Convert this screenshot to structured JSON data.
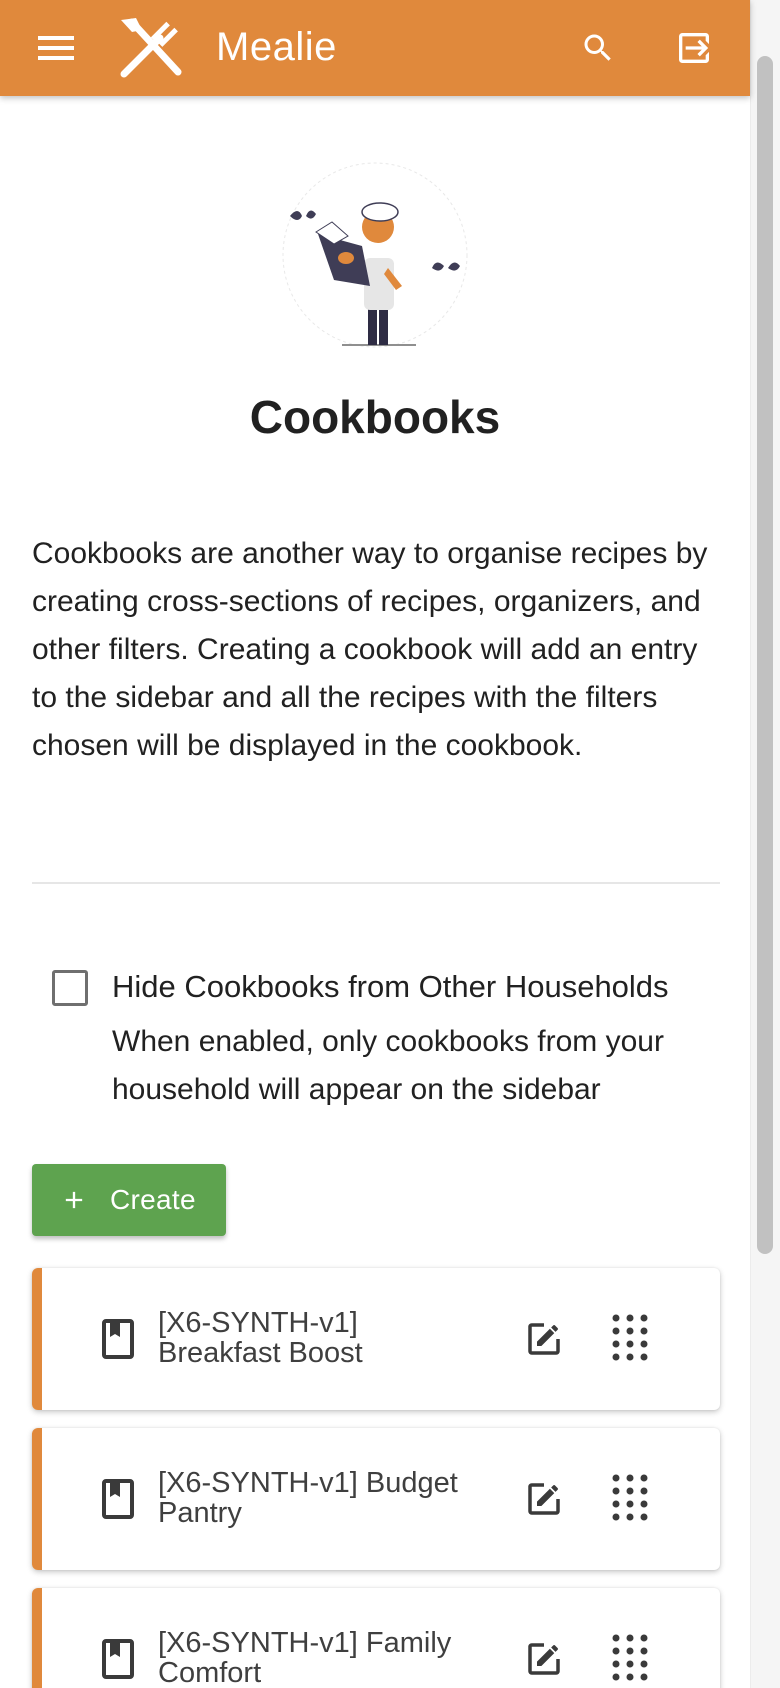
{
  "app": {
    "title": "Mealie"
  },
  "page": {
    "title": "Cookbooks",
    "description": "Cookbooks are another way to organise recipes by creating cross-sections of recipes, organizers, and other filters. Creating a cookbook will add an entry to the sidebar and all the recipes with the filters chosen will be displayed in the cookbook."
  },
  "settings": {
    "hide_label": "Hide Cookbooks from Other Households",
    "hide_hint": "When enabled, only cookbooks from your household will appear on the sidebar",
    "hide_checked": false
  },
  "actions": {
    "create_label": "Create"
  },
  "cookbooks": [
    {
      "name": "[X6-SYNTH-v1] Breakfast Boost"
    },
    {
      "name": "[X6-SYNTH-v1] Budget Pantry"
    },
    {
      "name": "[X6-SYNTH-v1] Family Comfort"
    }
  ],
  "colors": {
    "primary": "#e0893c",
    "success": "#5ea34f"
  },
  "icons": [
    "menu-icon",
    "logo-icon",
    "search-icon",
    "logout-icon",
    "plus-icon",
    "book-icon",
    "edit-icon",
    "drag-icon"
  ]
}
